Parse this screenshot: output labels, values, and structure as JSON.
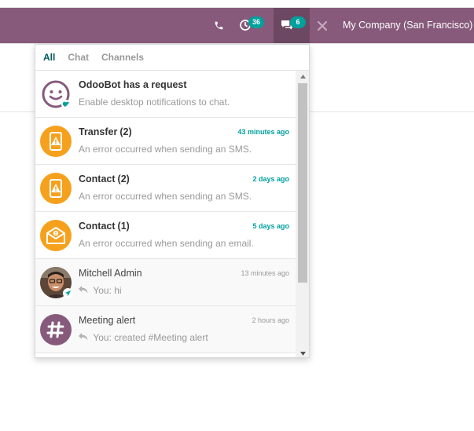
{
  "navbar": {
    "activity_count": "36",
    "messaging_count": "6",
    "company": "My Company (San Francisco)"
  },
  "messaging": {
    "filters": [
      "All",
      "Chat",
      "Channels"
    ],
    "active_filter": "All",
    "items": [
      {
        "title": "OdooBot has a request",
        "count": "",
        "date": "",
        "preview": "Enable desktop notifications to chat.",
        "avatar": "odoobot-icon"
      },
      {
        "title": "Transfer",
        "count": "(2)",
        "date": "43 minutes ago",
        "preview": "An error occurred when sending an SMS.",
        "avatar": "sms-failure-icon"
      },
      {
        "title": "Contact",
        "count": "(2)",
        "date": "2 days ago",
        "preview": "An error occurred when sending an SMS.",
        "avatar": "sms-failure-icon"
      },
      {
        "title": "Contact",
        "count": "(1)",
        "date": "5 days ago",
        "preview": "An error occurred when sending an email.",
        "avatar": "email-failure-icon"
      },
      {
        "title": "Mitchell Admin",
        "count": "",
        "date": "13 minutes ago",
        "preview": "You: hi",
        "avatar": "user-avatar"
      },
      {
        "title": "Meeting alert",
        "count": "",
        "date": "2 hours ago",
        "preview": "You: created #Meeting alert",
        "avatar": "channel-hash-icon"
      }
    ]
  },
  "colors": {
    "navbar": "#875a7b",
    "badge": "#00a09d",
    "failure_icon": "#f5a11d",
    "active_filter": "#01585e"
  }
}
